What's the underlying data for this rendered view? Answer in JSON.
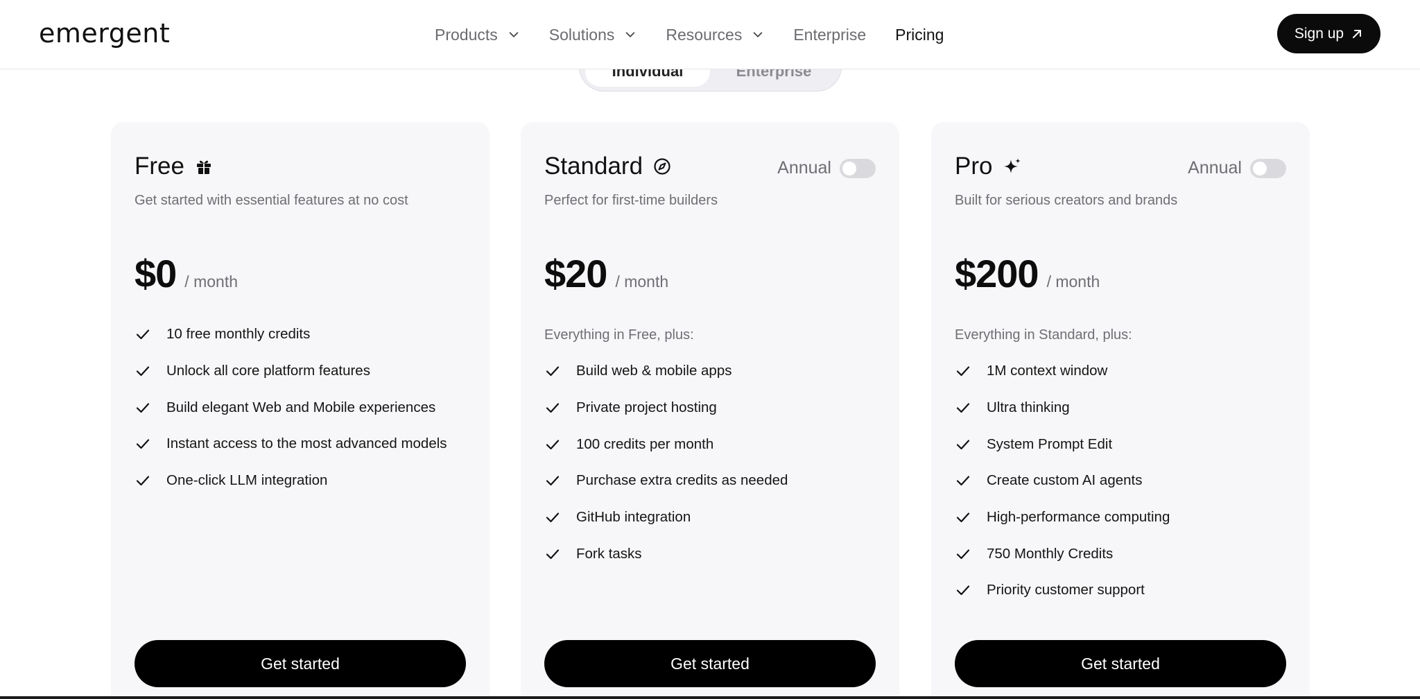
{
  "header": {
    "logo": "emergent",
    "nav": [
      {
        "label": "Products",
        "dropdown": true
      },
      {
        "label": "Solutions",
        "dropdown": true
      },
      {
        "label": "Resources",
        "dropdown": true
      },
      {
        "label": "Enterprise",
        "dropdown": false
      },
      {
        "label": "Pricing",
        "dropdown": false,
        "active": true
      }
    ],
    "signup_label": "Sign up"
  },
  "plan_toggle": {
    "options": [
      "Individual",
      "Enterprise"
    ],
    "selected": "Individual"
  },
  "plans": [
    {
      "name": "Free",
      "icon": "gift-icon",
      "subtitle": "Get started with essential features at no cost",
      "price": "$0",
      "period": "/ month",
      "annual_toggle": null,
      "lead": "",
      "features": [
        "10 free monthly credits",
        "Unlock all core platform features",
        "Build elegant Web and Mobile experiences",
        "Instant access to the most advanced models",
        "One-click LLM integration"
      ],
      "cta": "Get started"
    },
    {
      "name": "Standard",
      "icon": "compass-icon",
      "subtitle": "Perfect for first-time builders",
      "price": "$20",
      "period": "/ month",
      "annual_toggle": {
        "label": "Annual",
        "on": false
      },
      "lead": "Everything in Free, plus:",
      "features": [
        "Build web & mobile apps",
        "Private project hosting",
        "100 credits per month",
        "Purchase extra credits as needed",
        "GitHub integration",
        "Fork tasks"
      ],
      "cta": "Get started"
    },
    {
      "name": "Pro",
      "icon": "sparkle-icon",
      "subtitle": "Built for serious creators and brands",
      "price": "$200",
      "period": "/ month",
      "annual_toggle": {
        "label": "Annual",
        "on": false
      },
      "lead": "Everything in Standard, plus:",
      "features": [
        "1M context window",
        "Ultra thinking",
        "System Prompt Edit",
        "Create custom AI agents",
        "High-performance computing",
        "750 Monthly Credits",
        "Priority customer support"
      ],
      "cta": "Get started"
    }
  ],
  "colors": {
    "background": "#ffffff",
    "card": "#f7f6f8",
    "primary_button": "#000000",
    "muted_text": "#6e6e74",
    "nav_text": "#6b6b70"
  }
}
